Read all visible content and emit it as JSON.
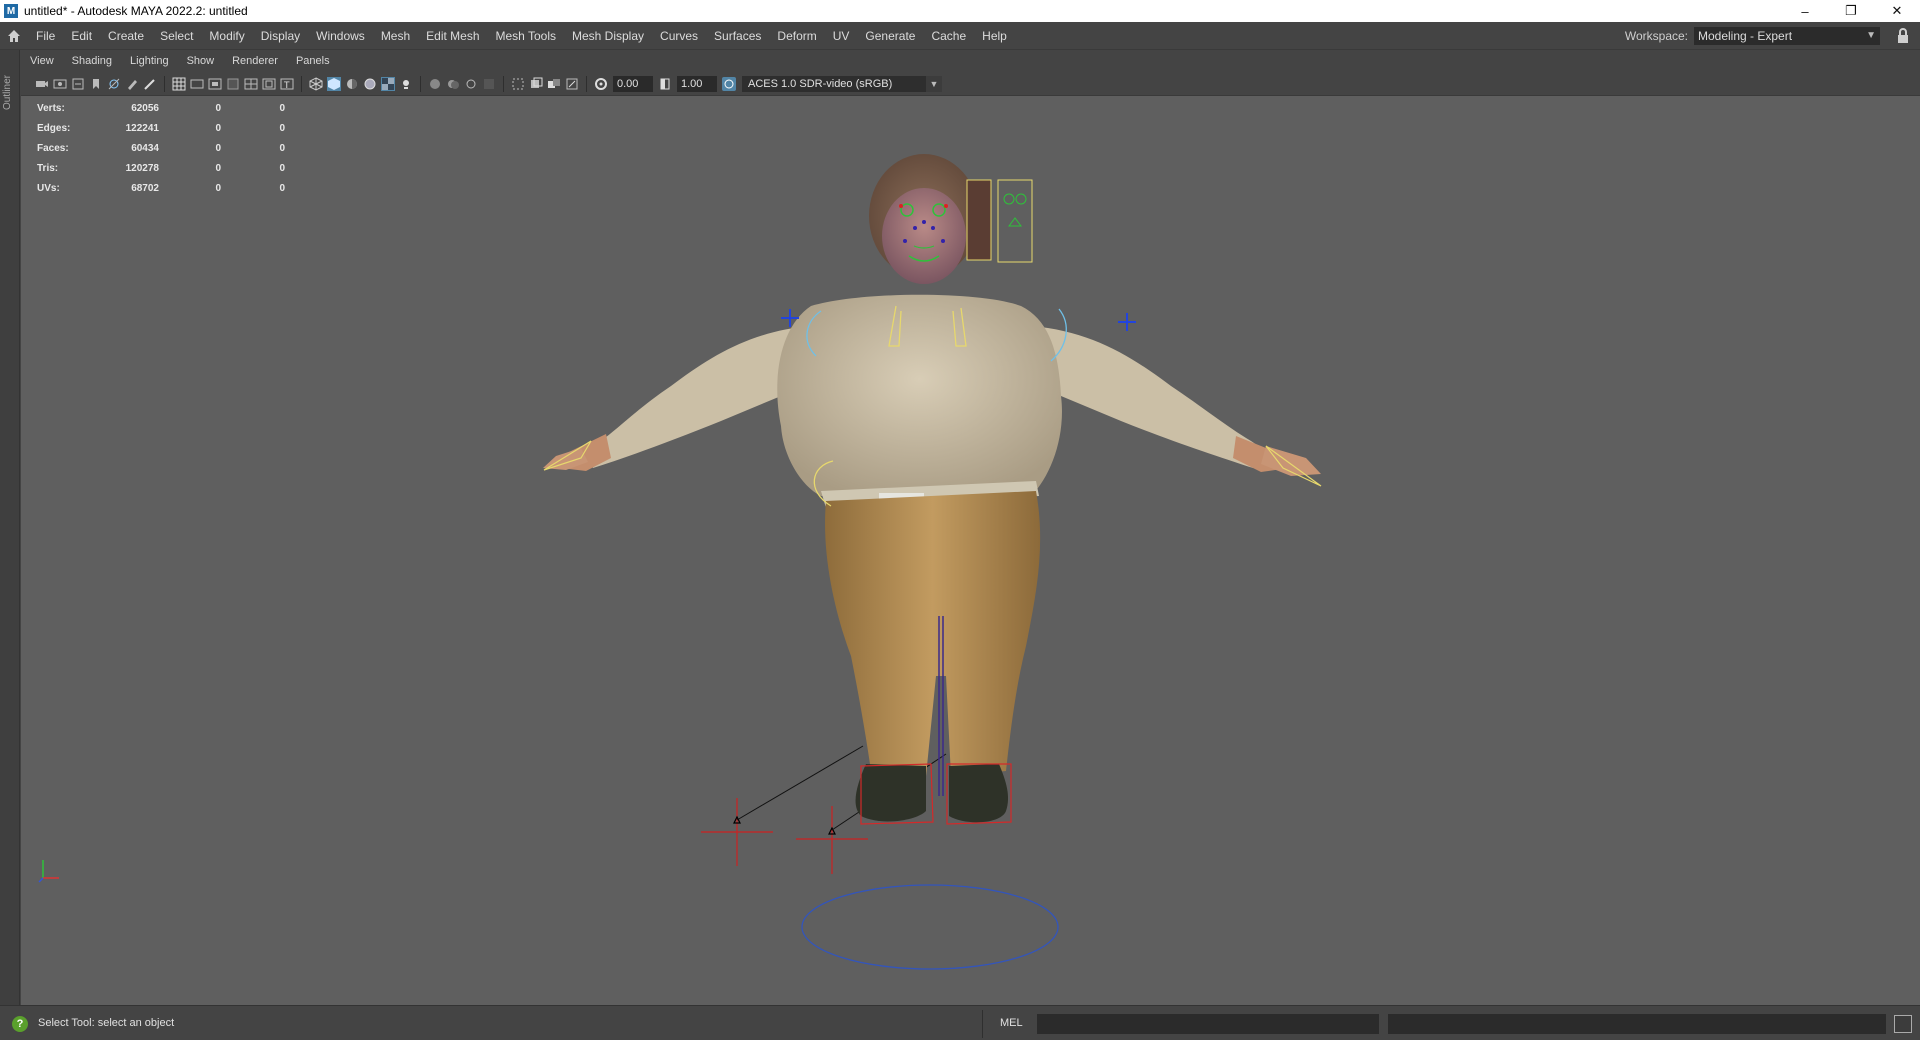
{
  "window": {
    "app_icon": "M",
    "title": "untitled* - Autodesk MAYA 2022.2: untitled",
    "controls": {
      "minimize": "–",
      "restore": "❐",
      "close": "✕"
    }
  },
  "menubar": {
    "items": [
      "File",
      "Edit",
      "Create",
      "Select",
      "Modify",
      "Display",
      "Windows",
      "Mesh",
      "Edit Mesh",
      "Mesh Tools",
      "Mesh Display",
      "Curves",
      "Surfaces",
      "Deform",
      "UV",
      "Generate",
      "Cache",
      "Help"
    ],
    "workspace_label": "Workspace:",
    "workspace_value": "Modeling - Expert"
  },
  "outliner_tab": "Outliner",
  "panel_menu": [
    "View",
    "Shading",
    "Lighting",
    "Show",
    "Renderer",
    "Panels"
  ],
  "toolbar": {
    "exposure": "0.00",
    "gamma": "1.00",
    "color_transform": "ACES 1.0 SDR-video (sRGB)"
  },
  "hud": {
    "rows": [
      {
        "label": "Verts:",
        "v1": "62056",
        "v2": "0",
        "v3": "0"
      },
      {
        "label": "Edges:",
        "v1": "122241",
        "v2": "0",
        "v3": "0"
      },
      {
        "label": "Faces:",
        "v1": "60434",
        "v2": "0",
        "v3": "0"
      },
      {
        "label": "Tris:",
        "v1": "120278",
        "v2": "0",
        "v3": "0"
      },
      {
        "label": "UVs:",
        "v1": "68702",
        "v2": "0",
        "v3": "0"
      }
    ]
  },
  "camera": "persp",
  "status": {
    "help_text": "Select Tool: select an object",
    "command_language": "MEL"
  },
  "colors": {
    "viewport_bg": "#5f5f5f",
    "ui_bg": "#444444",
    "sweater": "#c9bda5",
    "pants": "#b08a52",
    "skin": "#c9906f"
  }
}
